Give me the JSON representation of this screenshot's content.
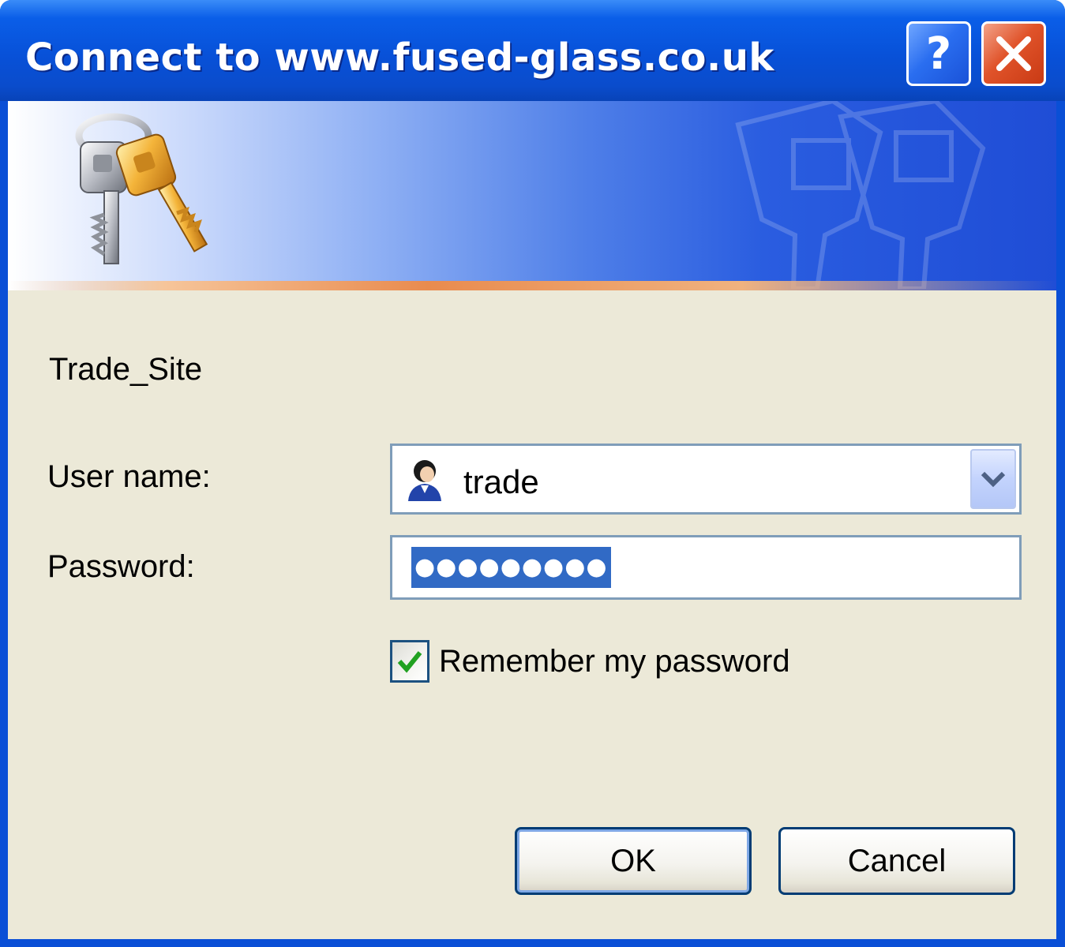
{
  "window": {
    "title": "Connect to www.fused-glass.co.uk",
    "help_icon": "question-mark",
    "close_icon": "close-x"
  },
  "banner": {
    "icon": "keys-icon"
  },
  "dialog": {
    "realm": "Trade_Site",
    "username_label": "User name:",
    "username_value": "trade",
    "username_icon": "user-icon",
    "password_label": "Password:",
    "password_mask": "●●●●●●●●●",
    "remember_label": "Remember my password",
    "remember_checked": true,
    "ok_label": "OK",
    "cancel_label": "Cancel"
  },
  "colors": {
    "titlebar": "#0a54e0",
    "client_bg": "#ece9d8",
    "selection": "#316ac5",
    "close_button": "#e0532a",
    "check": "#21a121"
  }
}
